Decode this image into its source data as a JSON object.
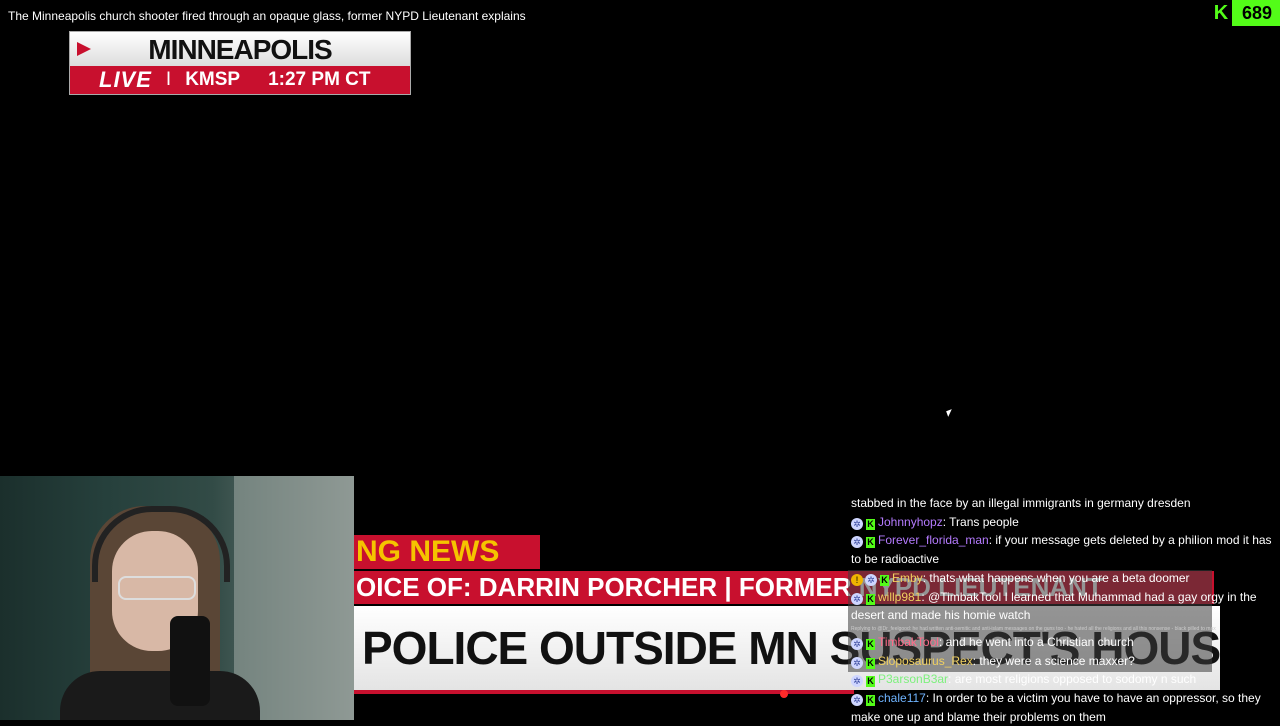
{
  "window": {
    "title": "The Minneapolis church shooter fired through an opaque glass, former NYPD Lieutenant explains"
  },
  "viewer_badge": {
    "icon": "kick-logo-icon",
    "logo_letter": "K",
    "count": "689",
    "color": "#53fc18"
  },
  "live_bug": {
    "city": "MINNEAPOLIS",
    "live": "LIVE",
    "separator": "I",
    "station": "KMSP",
    "time": "1:27 PM CT"
  },
  "lower_third": {
    "breaking": "NG NEWS",
    "voice": "OICE OF: DARRIN PORCHER | FORMER NYPD LIEUTENANT",
    "headline": "POLICE OUTSIDE MN SUSPECT'S HOUSE"
  },
  "chat": {
    "messages": [
      {
        "user": "",
        "text": "stabbed in the face by an illegal immigrants in germany dresden",
        "color": "#ffffff",
        "badges": []
      },
      {
        "user": "Johnnyhopz",
        "text": "Trans people",
        "color": "#b57bff",
        "badges": [
          "sub-icon",
          "kick-badge-icon"
        ]
      },
      {
        "user": "Forever_florida_man",
        "text": "if your message gets deleted by a philion mod it has to be radioactive",
        "color": "#b57bff",
        "badges": [
          "sub-icon",
          "kick-badge-icon"
        ]
      },
      {
        "user": "Emby",
        "text": "thats what happens when you are a beta doomer",
        "color": "#f0d060",
        "badges": [
          "mod-icon",
          "sub-icon",
          "kick-badge-icon"
        ]
      },
      {
        "user": "willp981",
        "text": "@TimbakTool I learned that Muhammad had a gay orgy in the desert and made his homie watch",
        "color": "#f0d060",
        "badges": [
          "sub-icon",
          "kick-badge-icon"
        ]
      },
      {
        "user": "TimbakTool",
        "text": "and he went into a Christian church",
        "color": "#ff6b8a",
        "badges": [
          "sub-icon",
          "kick-badge-icon"
        ],
        "reply": "Replying to @Dr_feelgood: he had written anti-semitic and anti-islam messages on the guns too - he hated all the religions and all this nonsense - black pilled to max"
      },
      {
        "user": "Sloposaurus_Rex",
        "text": "they were a science maxxer?",
        "color": "#f0d060",
        "badges": [
          "sub-icon",
          "kick-badge-icon"
        ]
      },
      {
        "user": "P3arsonB3ar",
        "text": "are most religions opposed to sodomy n such",
        "color": "#7ef07e",
        "badges": [
          "sub-icon",
          "kick-badge-icon"
        ]
      },
      {
        "user": "chale117",
        "text": "In order to be a victim you have to have an oppressor, so they make one up and blame their problems on them",
        "color": "#6fb4ff",
        "badges": [
          "sub-icon",
          "kick-badge-icon"
        ]
      }
    ]
  }
}
